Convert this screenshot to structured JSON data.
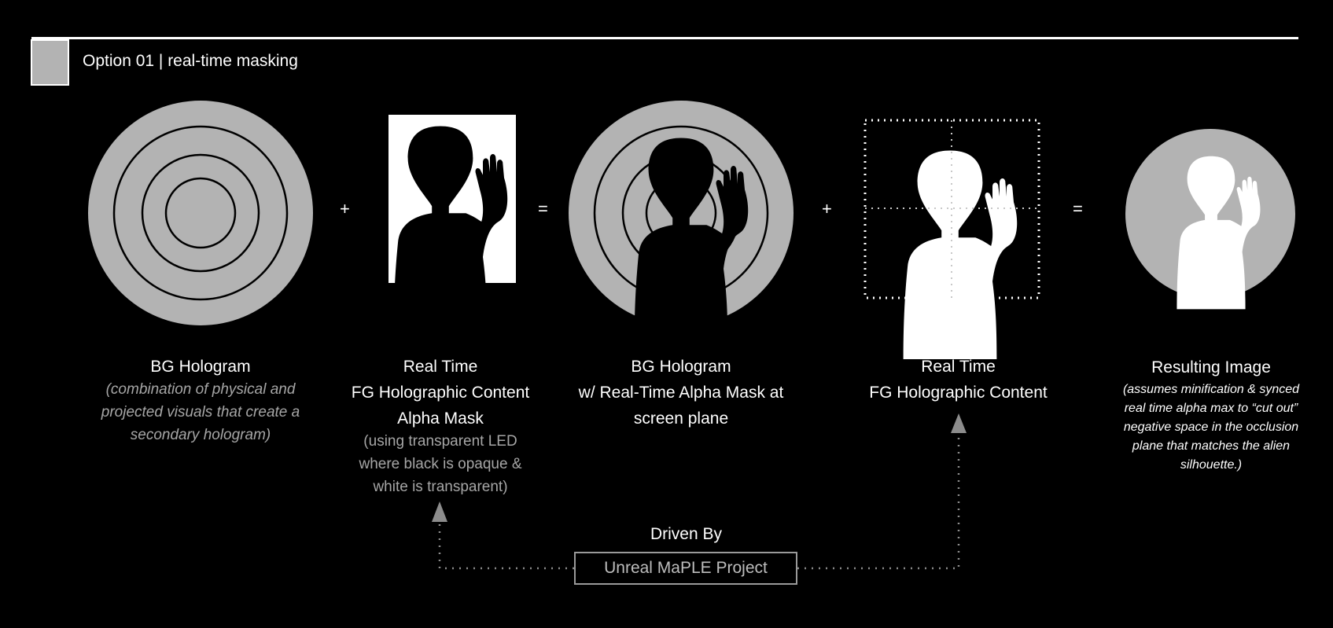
{
  "header": {
    "title": "Option 01 | real-time masking"
  },
  "operators": {
    "plus": "+",
    "equals": "="
  },
  "panels": [
    {
      "title_lines": [
        "BG Hologram"
      ],
      "note": "(combination of physical and projected visuals that create a secondary hologram)"
    },
    {
      "title_lines": [
        "Real Time",
        "FG Holographic Content",
        "Alpha Mask"
      ],
      "note": "(using transparent LED where black is opaque & white is transparent)"
    },
    {
      "title_lines": [
        "BG Hologram",
        "w/ Real-Time Alpha Mask at",
        "screen plane"
      ],
      "note": ""
    },
    {
      "title_lines": [
        "Real Time",
        "FG Holographic Content"
      ],
      "note": ""
    },
    {
      "title_lines": [
        "Resulting Image"
      ],
      "note": "(assumes minification & synced real time alpha max to “cut out” negative space in the occlusion plane that matches the alien silhouette.)"
    }
  ],
  "driver": {
    "label": "Driven By",
    "box_label": "Unreal MaPLE Project"
  },
  "colors": {
    "background": "#000000",
    "hologram_gray": "#b3b3b3",
    "muted_text": "#a6a6a6",
    "arrow_gray": "#8c8c8c"
  },
  "icons": [
    "hologram-rings-icon",
    "alien-mask-icon",
    "alien-silhouette-icon",
    "arrow-up-icon"
  ]
}
